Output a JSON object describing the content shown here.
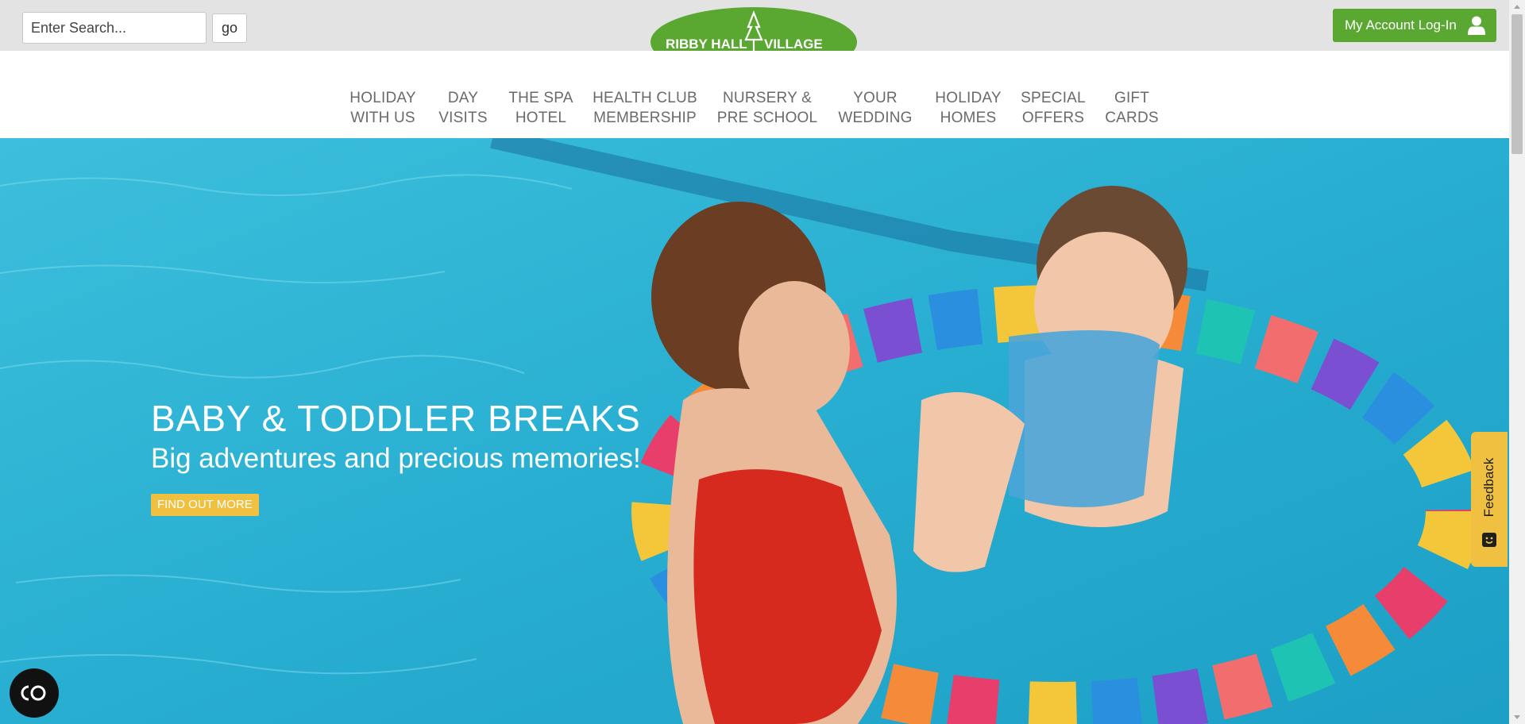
{
  "header": {
    "search": {
      "placeholder": "Enter Search...",
      "value": "",
      "go_label": "go"
    },
    "logo": {
      "text": "RIBBY HALL VILLAGE",
      "color": "#5aa832"
    },
    "account": {
      "label": "My Account Log-In",
      "icon": "user-icon"
    }
  },
  "nav": {
    "items": [
      {
        "line1": "HOLIDAY",
        "line2": "WITH US"
      },
      {
        "line1": "DAY",
        "line2": "VISITS"
      },
      {
        "line1": "THE SPA",
        "line2": "HOTEL"
      },
      {
        "line1": "HEALTH CLUB",
        "line2": "MEMBERSHIP"
      },
      {
        "line1": "NURSERY &",
        "line2": "PRE SCHOOL"
      },
      {
        "line1": "YOUR",
        "line2": "WEDDING"
      },
      {
        "line1": "HOLIDAY",
        "line2": "HOMES"
      },
      {
        "line1": "SPECIAL",
        "line2": "OFFERS"
      },
      {
        "line1": "GIFT",
        "line2": "CARDS"
      }
    ]
  },
  "hero": {
    "title": "BABY & TODDLER BREAKS",
    "subtitle": "Big adventures and precious memories!",
    "cta": "FIND OUT MORE",
    "image": "mother-and-baby-in-pool-with-colorful-float-ring"
  },
  "feedback": {
    "label": "Feedback",
    "icon": "smiley-icon"
  },
  "accessibility": {
    "icon": "accessibility-icon"
  },
  "colors": {
    "brand_green": "#5aa832",
    "accent_yellow": "#f0c040",
    "topbar_bg": "#e3e3e3",
    "nav_text": "#6a6a6a",
    "pool_blue": "#2fb2d3"
  }
}
